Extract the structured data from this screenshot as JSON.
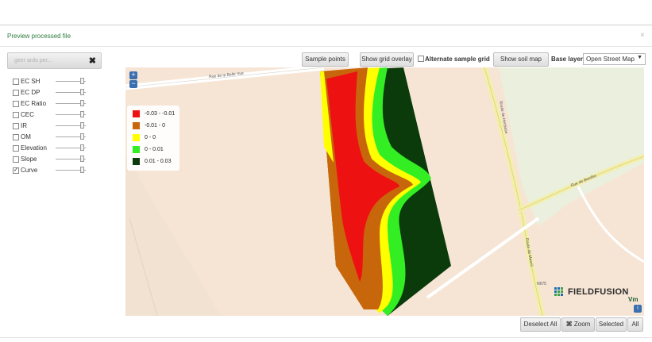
{
  "dialog": {
    "title": "Preview processed file",
    "close_icon": "×"
  },
  "file": {
    "name": "geer ardo per...",
    "remove_icon": "✖"
  },
  "layers": [
    {
      "label": "EC SH",
      "checked": false
    },
    {
      "label": "EC DP",
      "checked": false
    },
    {
      "label": "EC Ratio",
      "checked": false
    },
    {
      "label": "CEC",
      "checked": false
    },
    {
      "label": "IR",
      "checked": false
    },
    {
      "label": "OM",
      "checked": false
    },
    {
      "label": "Elevation",
      "checked": false
    },
    {
      "label": "Slope",
      "checked": false
    },
    {
      "label": "Curve",
      "checked": true
    }
  ],
  "toolbar": {
    "sample_points": "Sample points",
    "show_grid_overlay": "Show grid overlay",
    "alternate_sample_grid": "Alternate sample grid",
    "show_soil_map": "Show soil map",
    "base_layer_label": "Base layer:",
    "base_layer_value": "Open Street Map"
  },
  "map": {
    "zoom_in": "+",
    "zoom_out": "−",
    "info": "i",
    "roads": {
      "rue_belle_vue": "Rue de la Belle Vue",
      "route_herbisse": "Route de Herbisse",
      "route_boeilhe": "Rue de Boeilhe",
      "route_mesnil": "Route de Mesnil",
      "n675": "N675"
    },
    "legend": [
      {
        "range": "-0.03 - -0.01",
        "color": "#ee1111"
      },
      {
        "range": "-0.01 - 0",
        "color": "#c8660c"
      },
      {
        "range": "0 - 0",
        "color": "#ffff00"
      },
      {
        "range": "0 - 0.01",
        "color": "#33ee22"
      },
      {
        "range": "0.01 - 0.03",
        "color": "#0b3a0b"
      }
    ],
    "logo_text": "FIELDFUSION",
    "logo_sub": "Vm"
  },
  "bottom": {
    "deselect_all": "Deselect All",
    "zoom": "Zoom",
    "selected": "Selected",
    "all": "All"
  }
}
